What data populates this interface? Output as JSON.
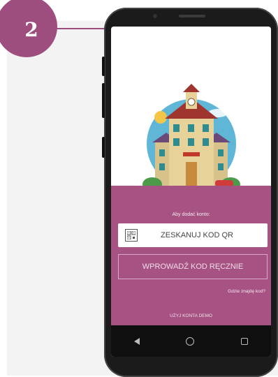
{
  "step": {
    "number": "2"
  },
  "screen": {
    "add_account_prompt": "Aby dodać konto:",
    "scan_button_label": "ZESKANUJ KOD QR",
    "manual_button_label": "WPROWADŹ KOD RĘCZNIE",
    "where_code_link": "Gdzie znajdę kod?",
    "demo_link": "UŻYJ KONTA DEMO"
  },
  "colors": {
    "accent": "#a65383",
    "badge": "#9e4e7e"
  },
  "icons": {
    "scan": "qr-code-icon",
    "nav_back": "back-triangle-icon",
    "nav_home": "home-circle-icon",
    "nav_recent": "recent-square-icon"
  }
}
